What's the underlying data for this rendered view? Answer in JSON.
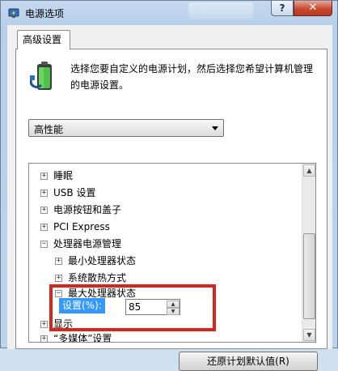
{
  "window": {
    "title": "电源选项",
    "help_label": "?",
    "close_label": "✕"
  },
  "tabs": [
    {
      "label": "高级设置"
    }
  ],
  "description": "选择您要自定义的电源计划，然后选择您希望计算机管理的电源设置。",
  "plan_select": {
    "selected": "高性能"
  },
  "tree": {
    "items": [
      {
        "expander": "+",
        "label": "睡眠"
      },
      {
        "expander": "+",
        "label": "USB 设置"
      },
      {
        "expander": "+",
        "label": "电源按钮和盖子"
      },
      {
        "expander": "+",
        "label": "PCI Express"
      },
      {
        "expander": "−",
        "label": "处理器电源管理"
      },
      {
        "expander": "+",
        "label": "最小处理器状态"
      },
      {
        "expander": "+",
        "label": "系统散热方式"
      },
      {
        "expander": "−",
        "label": "最大处理器状态"
      },
      {
        "expander": "+",
        "label": "显示"
      },
      {
        "expander": "+",
        "label": "“多媒体”设置"
      }
    ],
    "setting": {
      "label": "设置(%):",
      "value": "85"
    }
  },
  "buttons": {
    "restore_defaults": "还原计划默认值(R)"
  },
  "colors": {
    "highlight": "#d9241b",
    "selection": "#3399ff",
    "close": "#c74a30"
  }
}
